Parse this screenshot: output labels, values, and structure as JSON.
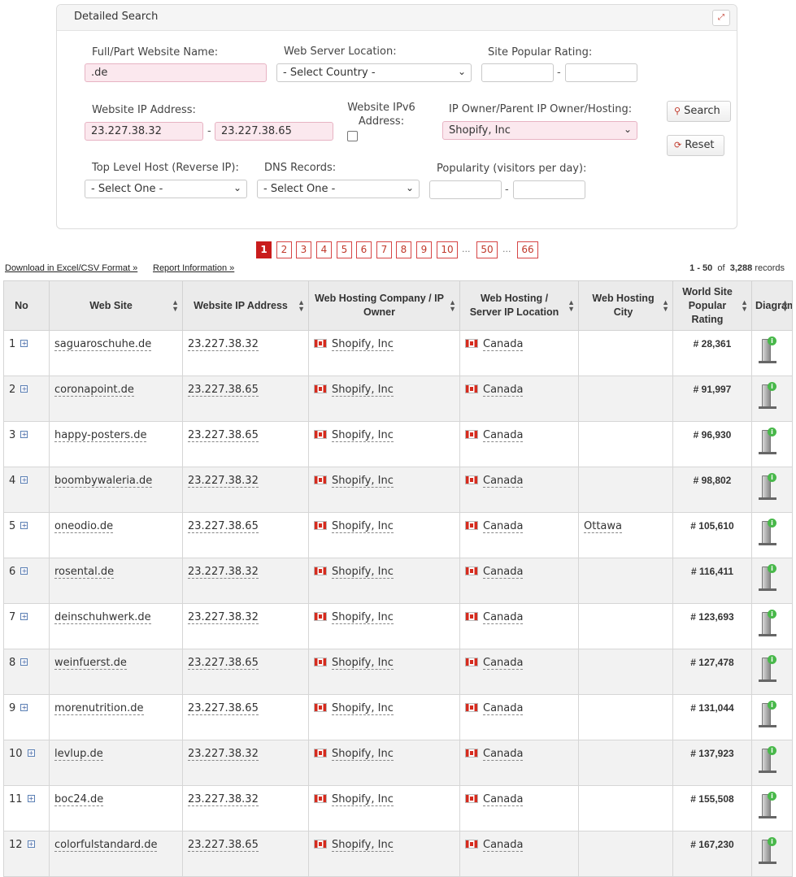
{
  "panel": {
    "title": "Detailed Search",
    "labels": {
      "website_name": "Full/Part Website Name:",
      "server_location": "Web Server Location:",
      "popular_rating": "Site Popular Rating:",
      "ip_address": "Website IP Address:",
      "ipv6": "Website IPv6 Address:",
      "ip_owner": "IP Owner/Parent IP Owner/Hosting:",
      "top_level_host": "Top Level Host (Reverse IP):",
      "dns_records": "DNS Records:",
      "popularity": "Popularity (visitors per day):"
    },
    "values": {
      "website_name": ".de",
      "server_location": "- Select Country -",
      "ip_from": "23.227.38.32",
      "ip_to": "23.227.38.65",
      "ip_owner": "Shopify, Inc",
      "top_level_host": "- Select One -",
      "dns_records": "- Select One -"
    },
    "buttons": {
      "search": "Search",
      "reset": "Reset"
    },
    "range_separator": "-"
  },
  "pagination": {
    "pages": [
      "1",
      "2",
      "3",
      "4",
      "5",
      "6",
      "7",
      "8",
      "9",
      "10"
    ],
    "ellipsis": "...",
    "page_50": "50",
    "page_last": "66",
    "active": "1"
  },
  "links": {
    "download": "Download in Excel/CSV Format »",
    "report": "Report Information »"
  },
  "records": {
    "range": "1 - 50",
    "of": "of",
    "total": "3,288",
    "suffix": "records"
  },
  "table": {
    "headers": [
      "No",
      "Web Site",
      "Website IP Address",
      "Web Hosting Company / IP Owner",
      "Web Hosting / Server IP Location",
      "Web Hosting City",
      "World Site Popular Rating",
      "Diagram"
    ],
    "rows": [
      {
        "no": "1",
        "site": "saguaroschuhe.de",
        "ip": "23.227.38.32",
        "owner": "Shopify, Inc",
        "location": "Canada",
        "city": "",
        "rating": "# 28,361"
      },
      {
        "no": "2",
        "site": "coronapoint.de",
        "ip": "23.227.38.65",
        "owner": "Shopify, Inc",
        "location": "Canada",
        "city": "",
        "rating": "# 91,997"
      },
      {
        "no": "3",
        "site": "happy-posters.de",
        "ip": "23.227.38.65",
        "owner": "Shopify, Inc",
        "location": "Canada",
        "city": "",
        "rating": "# 96,930"
      },
      {
        "no": "4",
        "site": "boombywaleria.de",
        "ip": "23.227.38.32",
        "owner": "Shopify, Inc",
        "location": "Canada",
        "city": "",
        "rating": "# 98,802"
      },
      {
        "no": "5",
        "site": "oneodio.de",
        "ip": "23.227.38.65",
        "owner": "Shopify, Inc",
        "location": "Canada",
        "city": "Ottawa",
        "rating": "# 105,610"
      },
      {
        "no": "6",
        "site": "rosental.de",
        "ip": "23.227.38.32",
        "owner": "Shopify, Inc",
        "location": "Canada",
        "city": "",
        "rating": "# 116,411"
      },
      {
        "no": "7",
        "site": "deinschuhwerk.de",
        "ip": "23.227.38.32",
        "owner": "Shopify, Inc",
        "location": "Canada",
        "city": "",
        "rating": "# 123,693"
      },
      {
        "no": "8",
        "site": "weinfuerst.de",
        "ip": "23.227.38.65",
        "owner": "Shopify, Inc",
        "location": "Canada",
        "city": "",
        "rating": "# 127,478"
      },
      {
        "no": "9",
        "site": "morenutrition.de",
        "ip": "23.227.38.65",
        "owner": "Shopify, Inc",
        "location": "Canada",
        "city": "",
        "rating": "# 131,044"
      },
      {
        "no": "10",
        "site": "levlup.de",
        "ip": "23.227.38.32",
        "owner": "Shopify, Inc",
        "location": "Canada",
        "city": "",
        "rating": "# 137,923"
      },
      {
        "no": "11",
        "site": "boc24.de",
        "ip": "23.227.38.32",
        "owner": "Shopify, Inc",
        "location": "Canada",
        "city": "",
        "rating": "# 155,508"
      },
      {
        "no": "12",
        "site": "colorfulstandard.de",
        "ip": "23.227.38.65",
        "owner": "Shopify, Inc",
        "location": "Canada",
        "city": "",
        "rating": "# 167,230"
      }
    ]
  },
  "icons": {
    "expand": "expand-icon",
    "search": "search-icon",
    "reset": "reset-icon",
    "plus": "plus-icon",
    "flag": "canada-flag-icon",
    "diagram": "server-diagram-icon"
  },
  "colors": {
    "accent": "#c91c1c",
    "pink_field": "#fbe8ee",
    "header_bg": "#ebebeb"
  }
}
